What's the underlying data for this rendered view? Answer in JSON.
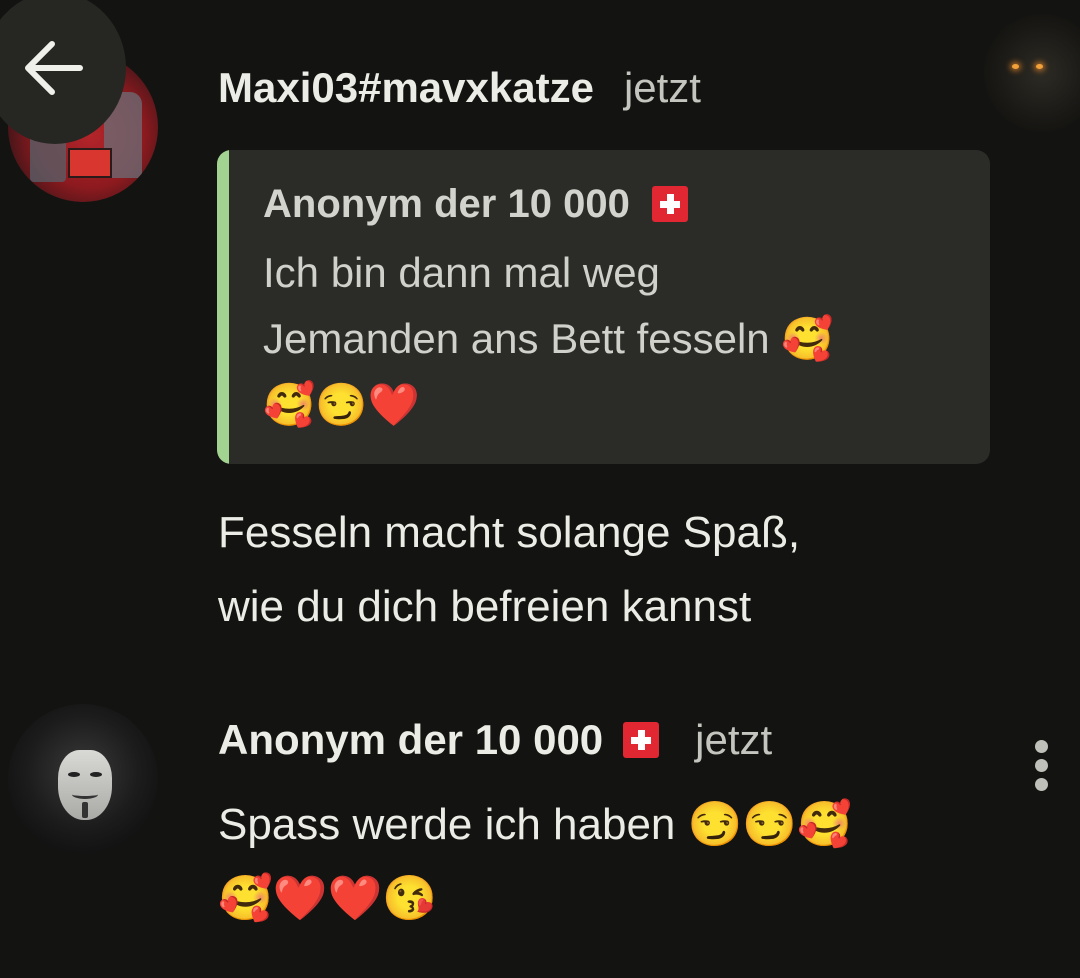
{
  "nav": {
    "back_icon": "arrow-left-icon"
  },
  "comments": [
    {
      "author": "Maxi03#mavxkatze",
      "time": "jetzt",
      "avatar_icon": "avatar-image",
      "quote": {
        "author": "Anonym der 10 000 🇨🇭",
        "author_name": "Anonym der 10 000",
        "flag_icon": "swiss-flag-icon",
        "text": "Ich bin dann mal weg\nJemanden ans Bett fesseln 🥰\n🥰😏❤️"
      },
      "text": "Fesseln macht solange Spaß,\nwie du dich befreien kannst"
    },
    {
      "author": "Anonym der 10 000 🇨🇭",
      "author_name": "Anonym der 10 000",
      "flag_icon": "swiss-flag-icon",
      "time": "jetzt",
      "avatar_icon": "avatar-image",
      "text": "Spass werde ich haben 😏😏🥰\n🥰❤️❤️😘"
    }
  ],
  "menu": {
    "more_icon": "more-vertical-icon"
  },
  "colors": {
    "background": "#131411",
    "quote_background": "#2b2c28",
    "quote_accent": "#a2d390",
    "swiss_red": "#e02732"
  }
}
